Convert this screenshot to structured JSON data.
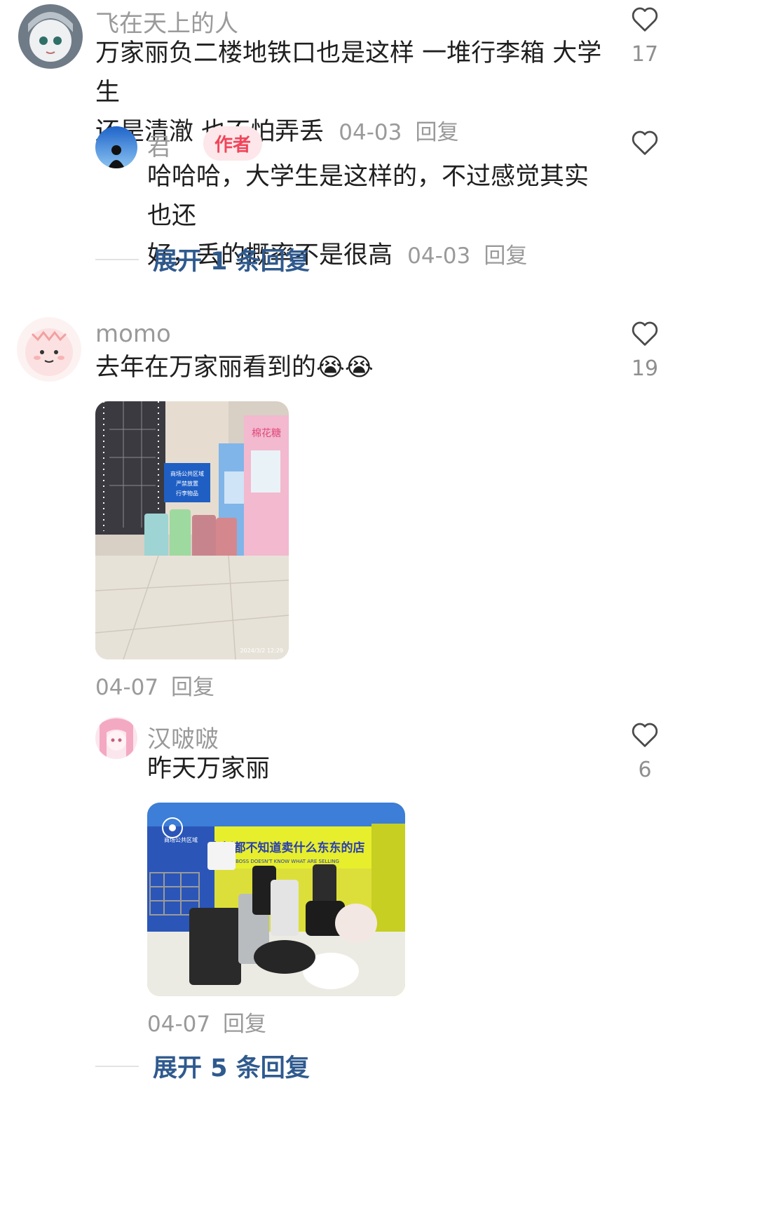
{
  "comments": [
    {
      "username": "飞在天上的人",
      "text": "万家丽负二楼地铁口也是这样 一堆行李箱 大学生还是清澈 也不怕弄丢",
      "line1": "万家丽负二楼地铁口也是这样  一堆行李箱  大学生",
      "line2": "还是清澈 也不怕弄丢",
      "date": "04-03",
      "reply_label": "回复",
      "likes": "17",
      "reply": {
        "username": "君",
        "badge": "作者",
        "line1": "哈哈哈，大学生是这样的，不过感觉其实也还",
        "line2": "好，丢的概率不是很高",
        "date": "04-03",
        "reply_label": "回复"
      },
      "expand_label": "展开 1 条回复"
    },
    {
      "username": "momo",
      "text": "去年在万家丽看到的",
      "emoji": "😭😭",
      "likes": "19",
      "photo": {
        "sign_text": "商场公共区域 严禁放置 行李物品",
        "machine_text": "棉花糖",
        "timestamp": "2024/3/2 12:29"
      },
      "date": "04-07",
      "reply_label": "回复"
    },
    {
      "username": "汉啵啵",
      "text": "昨天万家丽",
      "likes": "6",
      "photo": {
        "banner_text": "老板都不知道卖什么东东的店",
        "banner_sub": "BOSS DOESN'T KNOW WHAT ARE SELLING"
      },
      "date": "04-07",
      "reply_label": "回复",
      "expand_label": "展开 5 条回复"
    }
  ],
  "colors": {
    "badge_bg": "#fde7ea",
    "badge_text": "#f0455b",
    "expand_text": "#2f5a8e",
    "meta_gray": "#9a9a9a"
  },
  "icons": {
    "like": "heart-outline-icon"
  }
}
